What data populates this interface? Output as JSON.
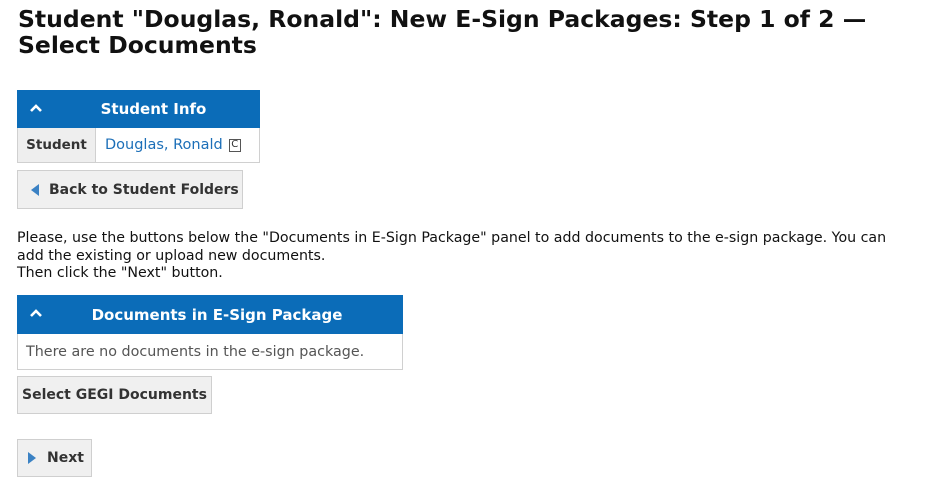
{
  "page": {
    "title": "Student \"Douglas, Ronald\": New E-Sign Packages: Step 1 of 2 — Select Documents"
  },
  "student_info_panel": {
    "header": "Student Info",
    "label": "Student",
    "value": "Douglas, Ronald",
    "badge": "C"
  },
  "buttons": {
    "back": "Back to Student Folders",
    "select_gegi": "Select GEGI Documents",
    "next": "Next"
  },
  "instructions": {
    "line1": "Please, use the buttons below the \"Documents in E-Sign Package\" panel to add documents to the e-sign package. You can add the existing or upload new documents.",
    "line2": "Then click the \"Next\" button."
  },
  "documents_panel": {
    "header": "Documents in E-Sign Package",
    "empty_message": "There are no documents in the e-sign package."
  },
  "colors": {
    "panel_header": "#0b6cb8",
    "link": "#1c6fb8",
    "button_bg": "#f0f0f0",
    "arrow": "#3b82c4"
  },
  "icons": [
    "chevron-up-icon",
    "chevron-left-icon",
    "chevron-right-icon",
    "c-badge-icon"
  ]
}
